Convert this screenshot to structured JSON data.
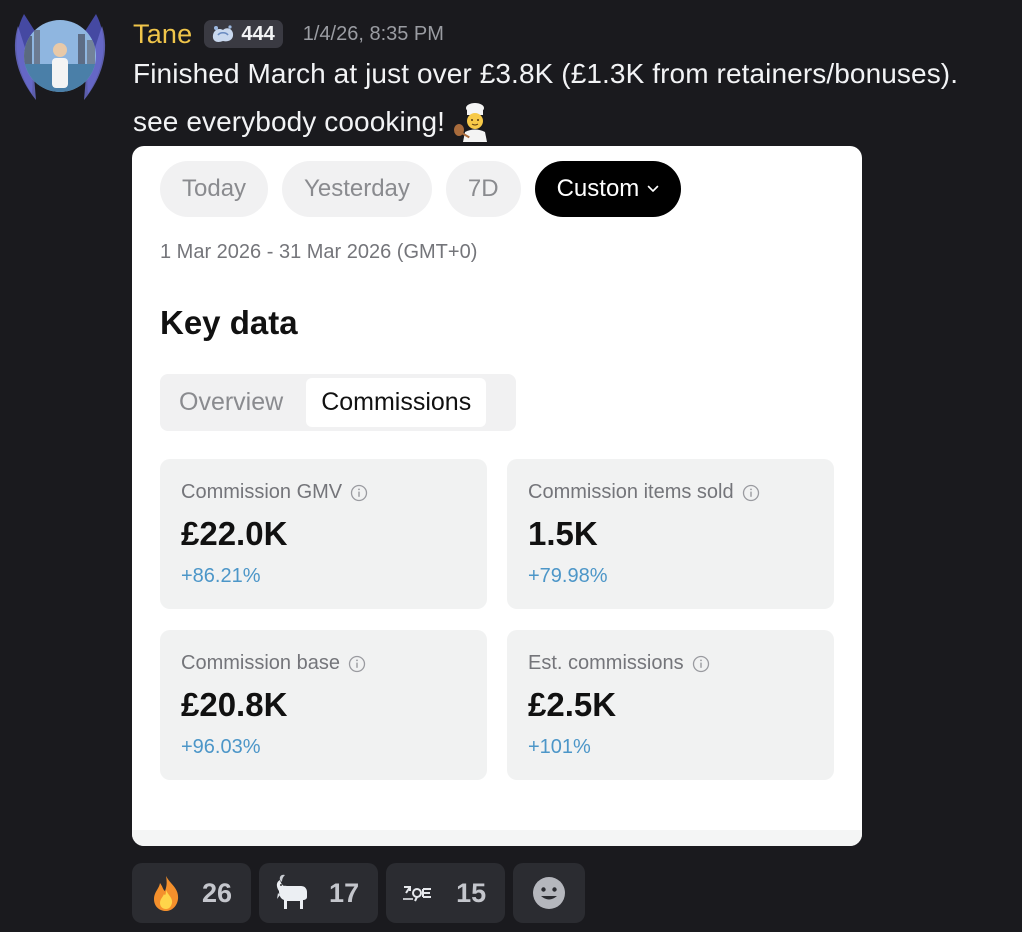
{
  "message": {
    "username": "Tane",
    "badge_count": "444",
    "timestamp": "1/4/26, 8:35 PM",
    "line1": "Finished March at just over £3.8K (£1.3K from retainers/bonuses).",
    "line2": "see everybody coooking!"
  },
  "screenshot": {
    "pills": [
      "Today",
      "Yesterday",
      "7D",
      "Custom"
    ],
    "active_pill": "Custom",
    "date_range": "1 Mar 2026 - 31 Mar 2026 (GMT+0)",
    "section_title": "Key data",
    "segments": [
      "Overview",
      "Commissions"
    ],
    "active_segment": "Commissions",
    "metrics": [
      {
        "label": "Commission GMV",
        "value": "£22.0K",
        "change": "+86.21%"
      },
      {
        "label": "Commission items sold",
        "value": "1.5K",
        "change": "+79.98%"
      },
      {
        "label": "Commission base",
        "value": "£20.8K",
        "change": "+96.03%"
      },
      {
        "label": "Est. commissions",
        "value": "£2.5K",
        "change": "+101%"
      }
    ]
  },
  "reactions": [
    {
      "icon": "fire-icon",
      "count": "26"
    },
    {
      "icon": "goat-icon",
      "count": "17"
    },
    {
      "icon": "custom-emoji-icon",
      "count": "15"
    }
  ],
  "colors": {
    "background": "#1a1a1e",
    "username": "#f0c54a",
    "positive_change": "#4c96c8",
    "active_pill": "#000000"
  }
}
